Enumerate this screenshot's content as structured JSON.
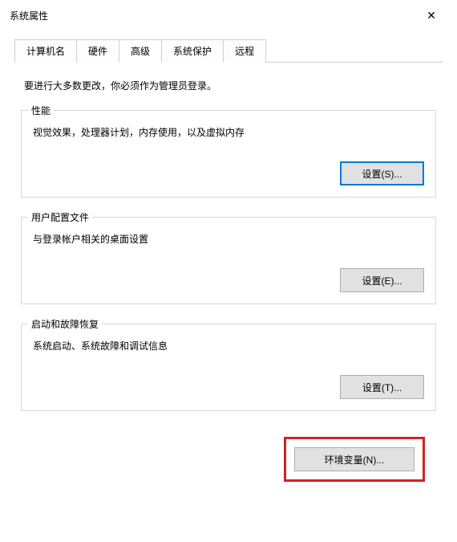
{
  "window": {
    "title": "系统属性",
    "close_icon": "✕"
  },
  "tabs": {
    "items": [
      {
        "label": "计算机名"
      },
      {
        "label": "硬件"
      },
      {
        "label": "高级"
      },
      {
        "label": "系统保护"
      },
      {
        "label": "远程"
      }
    ],
    "active_index": 2
  },
  "admin_note": "要进行大多数更改，你必须作为管理员登录。",
  "groups": {
    "performance": {
      "title": "性能",
      "desc": "视觉效果，处理器计划，内存使用，以及虚拟内存",
      "button": "设置(S)..."
    },
    "profiles": {
      "title": "用户配置文件",
      "desc": "与登录帐户相关的桌面设置",
      "button": "设置(E)..."
    },
    "startup": {
      "title": "启动和故障恢复",
      "desc": "系统启动、系统故障和调试信息",
      "button": "设置(T)..."
    }
  },
  "env_button": "环境变量(N)..."
}
